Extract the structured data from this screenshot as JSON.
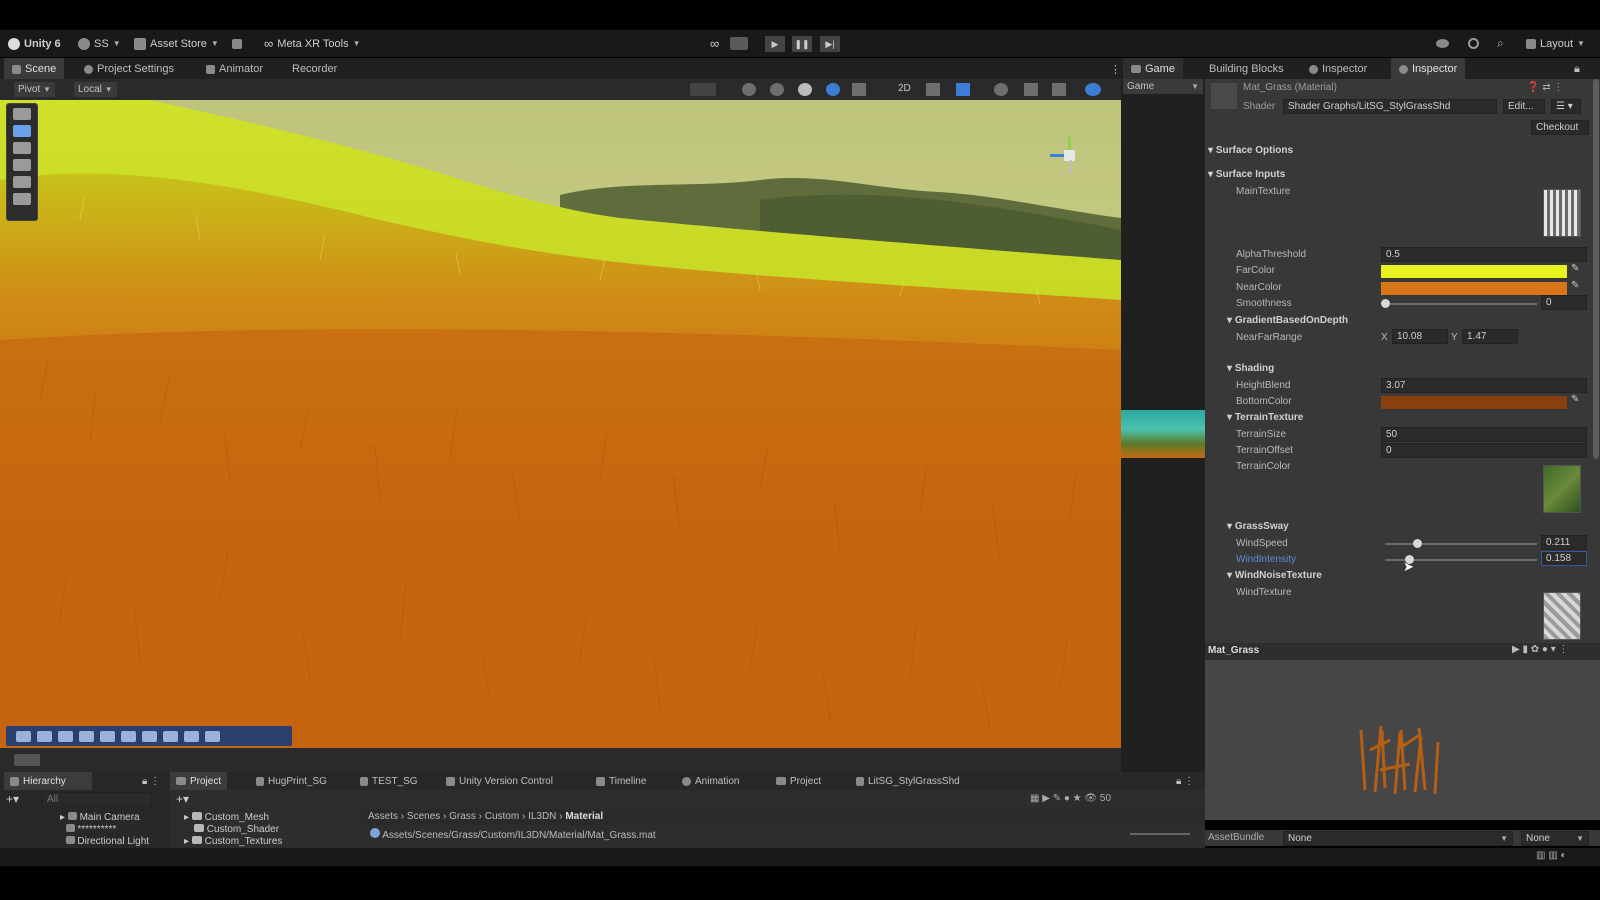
{
  "toolbar": {
    "unity": "Unity 6",
    "account": "SS",
    "asset_store": "Asset Store",
    "meta_tools": "Meta XR Tools",
    "layout": "Layout"
  },
  "left_tabs": [
    "Scene",
    "Project Settings",
    "Animator",
    "Recorder"
  ],
  "right_tabs": [
    "Game",
    "Building Blocks",
    "Inspector",
    "Inspector"
  ],
  "scene": {
    "pivot": "Pivot",
    "local": "Local",
    "mode_2d": "2D",
    "game_display": "Game"
  },
  "inspector": {
    "material_name": "Mat_Grass (Material)",
    "shader_label": "Shader",
    "shader_value": "Shader Graphs/LitSG_StylGrassShd",
    "edit": "Edit...",
    "checkout": "Checkout",
    "surface_options": "Surface Options",
    "surface_inputs": "Surface Inputs",
    "props": {
      "main_texture": "MainTexture",
      "alpha_threshold": "AlphaThreshold",
      "alpha_threshold_value": "0.5",
      "far_color": "FarColor",
      "near_color": "NearColor",
      "smoothness": "Smoothness",
      "smoothness_value": "0",
      "gradient_group": "GradientBasedOnDepth",
      "near_far_range": "NearFarRange",
      "x_label": "X",
      "x_value": "10.08",
      "y_label": "Y",
      "y_value": "1.47",
      "shading_group": "Shading",
      "height_blend": "HeightBlend",
      "height_blend_value": "3.07",
      "bottom_color": "BottomColor",
      "terrain_group": "TerrainTexture",
      "terrain_size": "TerrainSize",
      "terrain_size_value": "50",
      "terrain_offset": "TerrainOffset",
      "terrain_offset_value": "0",
      "terrain_color": "TerrainColor",
      "sway_group": "GrassSway",
      "wind_speed": "WindSpeed",
      "wind_speed_value": "0.211",
      "wind_speed_level": 0.21,
      "wind_intensity": "WindIntensity",
      "wind_intensity_value": "0.158",
      "wind_intensity_level": 0.16,
      "wind_noise_group": "WindNoiseTexture",
      "wind_texture": "WindTexture"
    },
    "preview_title": "Mat_Grass",
    "asset_bundle_label": "AssetBundle",
    "asset_bundle_value": "None",
    "asset_bundle_variant": "None"
  },
  "colors": {
    "far_color": "#e8f21e",
    "near_color": "#d9761a",
    "bottom_color": "#8a3f0e",
    "accent": "#2f5da0"
  },
  "bottom": {
    "hierarchy_tab": "Hierarchy",
    "tabs": [
      "Project",
      "HugPrint_SG",
      "TEST_SG",
      "Unity Version Control",
      "Timeline",
      "Animation",
      "Project",
      "LitSG_StylGrassShd"
    ],
    "search_placeholder": "All",
    "hierarchy_items": [
      "Main Camera",
      "**********",
      "Directional Light"
    ],
    "folders": [
      "Custom_Mesh",
      "Custom_Shader",
      "Custom_Textures"
    ],
    "breadcrumb": [
      "Assets",
      "Scenes",
      "Grass",
      "Custom",
      "IL3DN",
      "Material"
    ],
    "path": "Assets/Scenes/Grass/Custom/IL3DN/Material/Mat_Grass.mat",
    "count": "50"
  }
}
